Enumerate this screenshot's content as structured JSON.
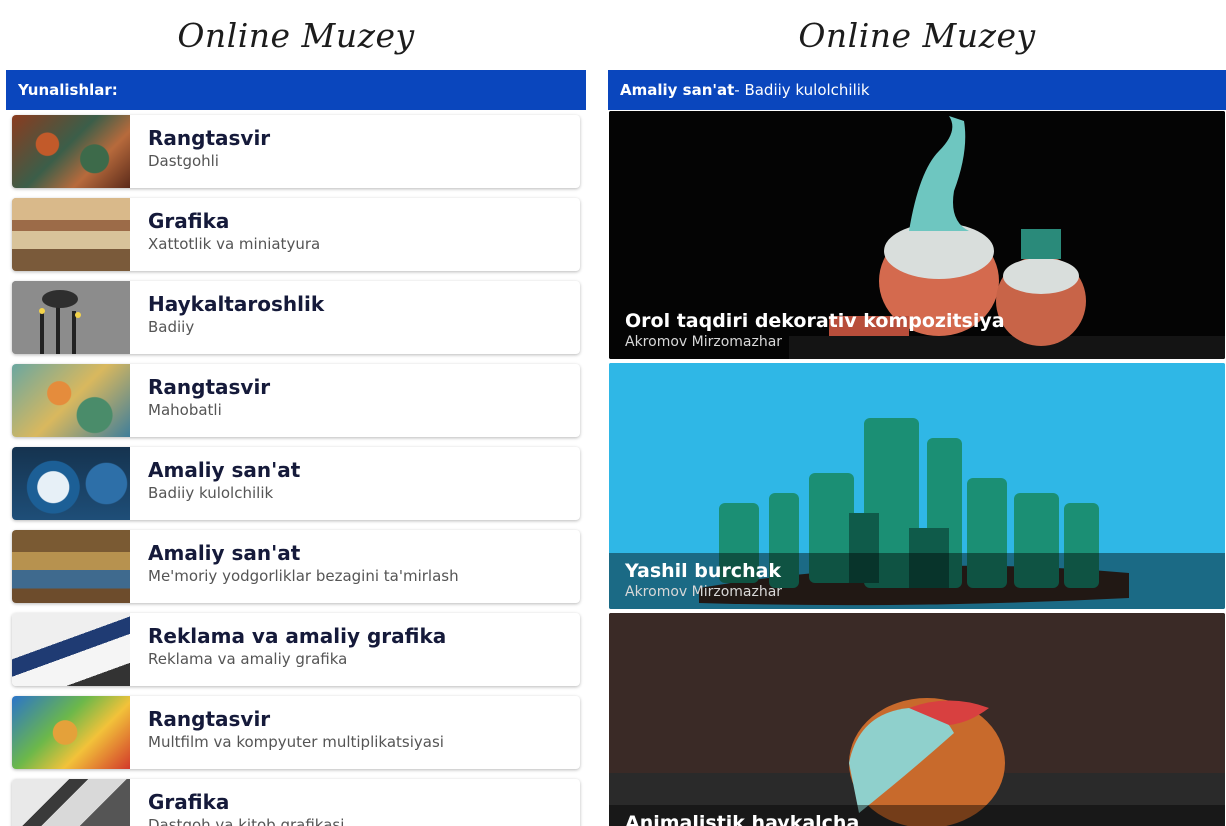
{
  "left": {
    "app_title": "Online Muzey",
    "section_label": "Yunalishlar:",
    "categories": [
      {
        "title": "Rangtasvir",
        "subtitle": "Dastgohli"
      },
      {
        "title": "Grafika",
        "subtitle": "Xattotlik va miniatyura"
      },
      {
        "title": "Haykaltaroshlik",
        "subtitle": "Badiiy"
      },
      {
        "title": "Rangtasvir",
        "subtitle": "Mahobatli"
      },
      {
        "title": "Amaliy san'at",
        "subtitle": "Badiiy kulolchilik"
      },
      {
        "title": "Amaliy san'at",
        "subtitle": "Me'moriy yodgorliklar bezagini ta'mirlash"
      },
      {
        "title": "Reklama va amaliy grafika",
        "subtitle": "Reklama va amaliy grafika"
      },
      {
        "title": "Rangtasvir",
        "subtitle": "Multfilm va kompyuter multiplikatsiyasi"
      },
      {
        "title": "Grafika",
        "subtitle": "Dastgoh va kitob grafikasi"
      }
    ]
  },
  "right": {
    "app_title": "Online Muzey",
    "section_category": "Amaliy san'at",
    "section_sub": " - Badiiy kulolchilik",
    "artworks": [
      {
        "title": "Orol taqdiri dekorativ kompozitsiya",
        "artist": "Akromov Mirzomazhar"
      },
      {
        "title": "Yashil burchak",
        "artist": "Akromov Mirzomazhar"
      },
      {
        "title": "Animalistik haykalcha",
        "artist": ""
      }
    ]
  },
  "colors": {
    "header_bar": "#0a46bd",
    "title_text": "#151a3a"
  }
}
